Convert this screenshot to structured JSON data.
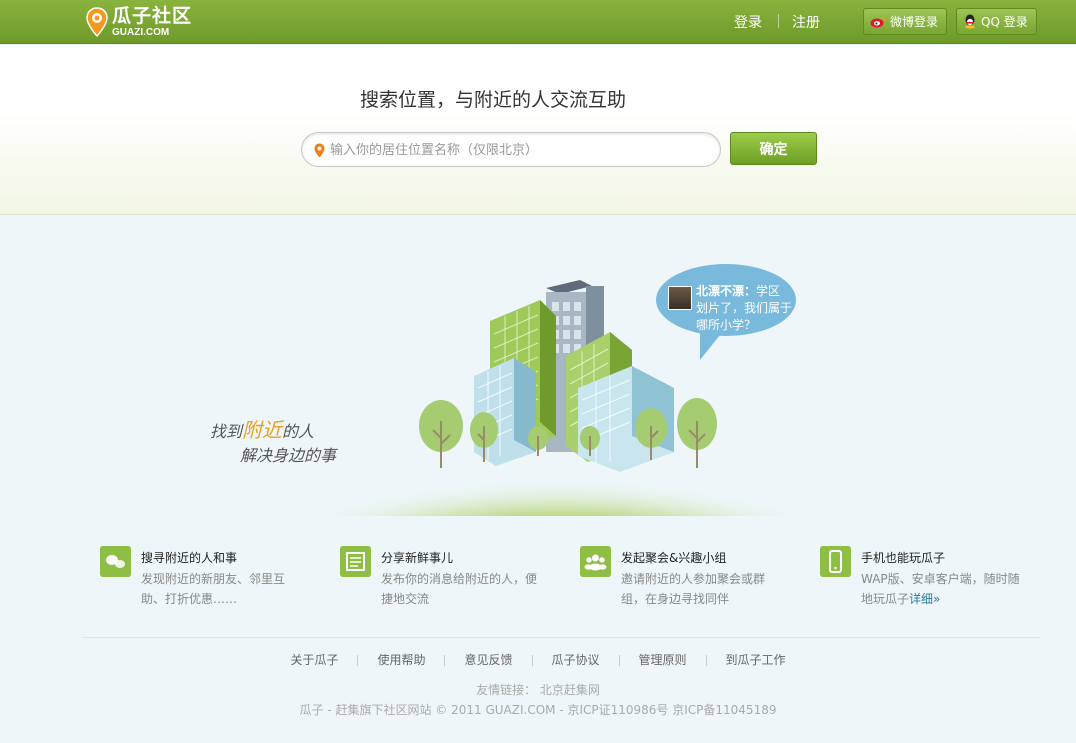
{
  "brand": {
    "name_cn": "瓜子社区",
    "name_en": "GUAZI.COM"
  },
  "header": {
    "login": "登录",
    "register": "注册",
    "weibo_login": "微博登录",
    "qq_login": "QQ 登录"
  },
  "search": {
    "headline": "搜索位置，与附近的人交流互助",
    "placeholder": "输入你的居住位置名称（仅限北京）",
    "confirm": "确定"
  },
  "illustration": {
    "slogan_line1_prefix": "找到",
    "slogan_line1_highlight": "附近",
    "slogan_line1_suffix": "的人",
    "slogan_line2": "解决身边的事",
    "bubble_name": "北漂不漂：",
    "bubble_text": "学区划片了，我们属于哪所小学？"
  },
  "features": [
    {
      "title": "搜寻附近的人和事",
      "desc": "发现附近的新朋友、邻里互助、打折优惠……",
      "icon": "chat-icon"
    },
    {
      "title": "分享新鲜事儿",
      "desc": "发布你的消息给附近的人，便捷地交流",
      "icon": "list-icon"
    },
    {
      "title": "发起聚会&兴趣小组",
      "desc": "邀请附近的人参加聚会或群组，在身边寻找同伴",
      "icon": "group-icon"
    },
    {
      "title": "手机也能玩瓜子",
      "desc": "WAP版、安卓客户端，随时随地玩瓜子",
      "link": "详细»",
      "icon": "mobile-icon"
    }
  ],
  "footer": {
    "links": [
      "关于瓜子",
      "使用帮助",
      "意见反馈",
      "瓜子协议",
      "管理原则",
      "到瓜子工作"
    ],
    "friend_label": "友情链接：",
    "friend_site": "北京赶集网",
    "copyright": "瓜子 - 赶集旗下社区网站 © 2011 GUAZI.COM - 京ICP证110986号 京ICP备11045189"
  },
  "colors": {
    "topbar": "#7aa533",
    "accent_green": "#8fbe45",
    "bubble": "#78b9dc",
    "slogan_highlight": "#e8a21b"
  }
}
